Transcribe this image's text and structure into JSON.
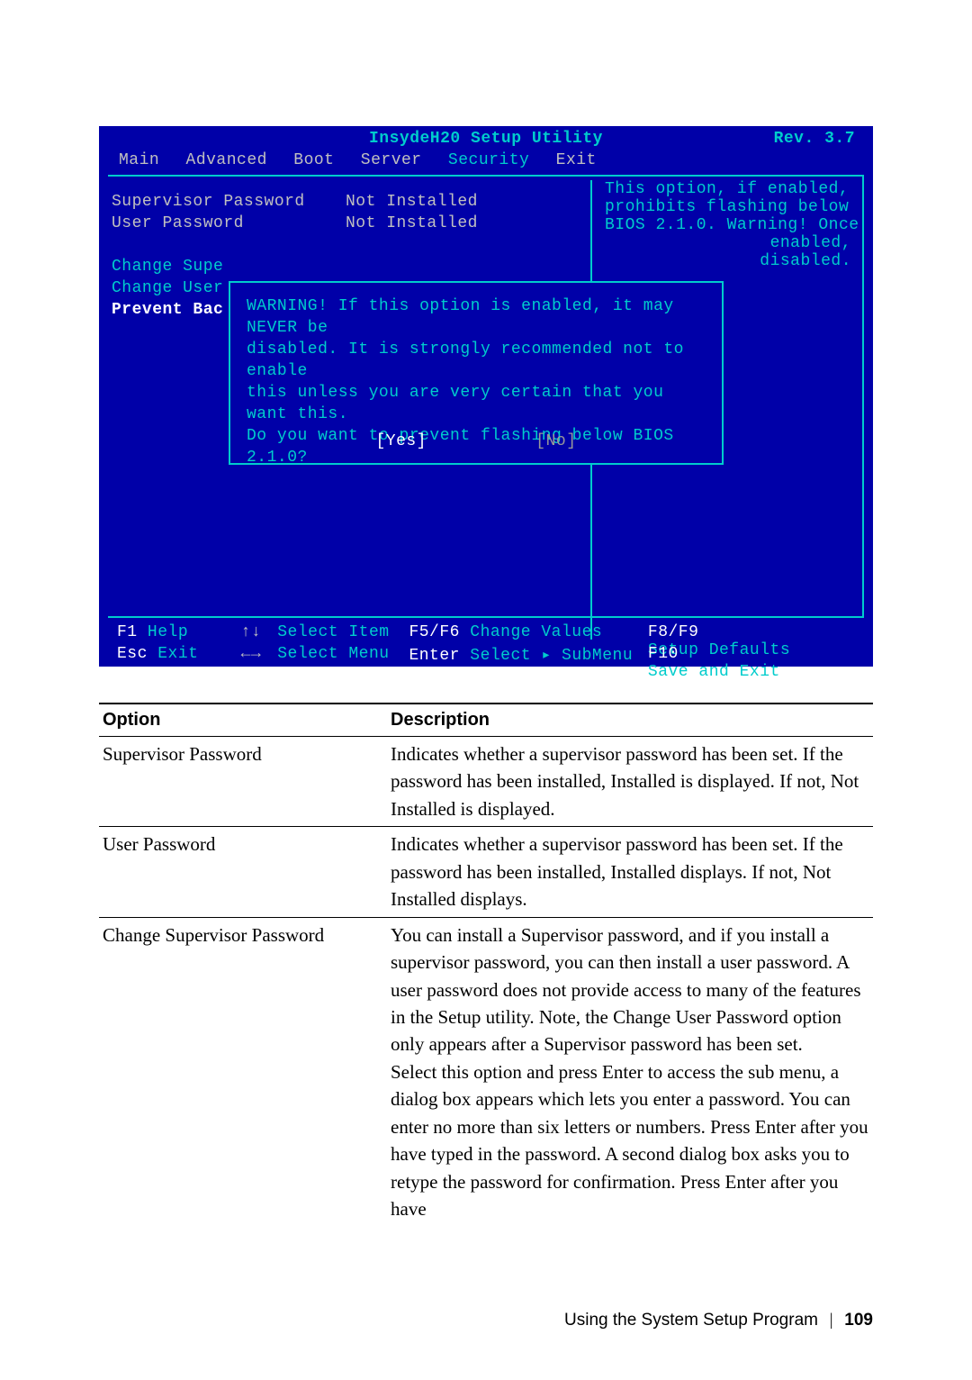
{
  "bios": {
    "title": "InsydeH20 Setup Utility",
    "rev": "Rev. 3.7",
    "tabs": [
      "Main",
      "Advanced",
      "Boot",
      "Server",
      "Security",
      "Exit"
    ],
    "active_tab": "Security",
    "fields": {
      "supervisor_password_label": "Supervisor Password",
      "supervisor_password_value": "Not Installed",
      "user_password_label": "User Password",
      "user_password_value": "Not Installed",
      "change_supervisor": "Change Supe",
      "change_user": "Change User",
      "prevent_back": "Prevent Bac"
    },
    "help_text_lines": [
      "This option, if enabled,",
      "prohibits flashing below",
      "BIOS 2.1.0. Warning! Once",
      "enabled,",
      "disabled."
    ],
    "dialog": {
      "lines": [
        "WARNING! If this option is enabled, it may NEVER be",
        "disabled. It is strongly recommended not to enable",
        "this unless you are very certain that you want this.",
        "Do you want to prevent flashing below BIOS 2.1.0?"
      ],
      "yes": "[Yes]",
      "no": "[No]"
    },
    "footer": {
      "f1_key": "F1",
      "f1_label": "Help",
      "arrows_v": "↑↓",
      "arrows_v_label": "Select Item",
      "f5f6_key": "F5/F6",
      "f5f6_label": "Change Values",
      "f8f9_key": "F8/F9",
      "f8f9_label": "Setup Defaults",
      "esc_key": "Esc",
      "esc_label": "Exit",
      "arrows_h": "←→",
      "arrows_h_label": "Select Menu",
      "enter_key": "Enter",
      "enter_label": "Select ▸ SubMenu",
      "f10_key": "F10",
      "f10_label": "Save and Exit"
    }
  },
  "table": {
    "header_option": "Option",
    "header_description": "Description",
    "rows": [
      {
        "option": "Supervisor Password",
        "description": "Indicates whether a supervisor password has been set. If the password has been installed, Installed is displayed. If not, Not Installed is displayed."
      },
      {
        "option": "User Password",
        "description": "Indicates whether a supervisor password has been set. If the password has been installed, Installed displays. If not, Not Installed displays."
      },
      {
        "option": "Change Supervisor Password",
        "description": "You can install a Supervisor password, and if you install a supervisor password, you can then install a user password. A user password does not provide access to many of the features in the Setup utility. Note, the Change User Password option only appears after a Supervisor password has been set.\nSelect this option and press Enter to access the sub menu, a dialog box appears which lets you enter a password. You can enter no more than six letters or numbers. Press Enter after you have typed in the password. A second dialog box asks you to retype the password for confirmation. Press Enter after you have"
      }
    ]
  },
  "footer": {
    "section": "Using the System Setup Program",
    "divider": "|",
    "page": "109"
  }
}
